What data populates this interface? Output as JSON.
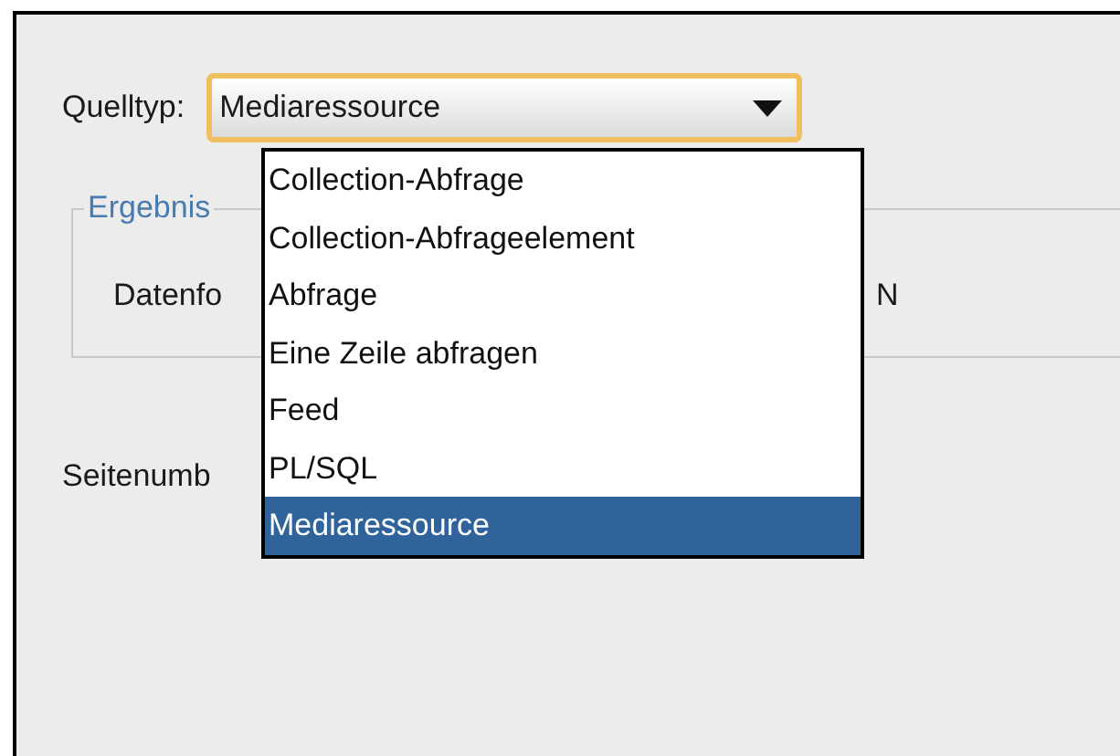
{
  "source_type": {
    "label": "Quelltyp:",
    "value": "Mediaressource",
    "options": [
      {
        "label": "Collection-Abfrage",
        "selected": false
      },
      {
        "label": "Collection-Abfrageelement",
        "selected": false
      },
      {
        "label": "Abfrage",
        "selected": false
      },
      {
        "label": "Eine Zeile abfragen",
        "selected": false
      },
      {
        "label": "Feed",
        "selected": false
      },
      {
        "label": "PL/SQL",
        "selected": false
      },
      {
        "label": "Mediaressource",
        "selected": true
      }
    ]
  },
  "result_group": {
    "title": "Ergebnis",
    "data_format_label": "Datenfo",
    "data_format_value": "N"
  },
  "paging_label": "Seitenumb"
}
